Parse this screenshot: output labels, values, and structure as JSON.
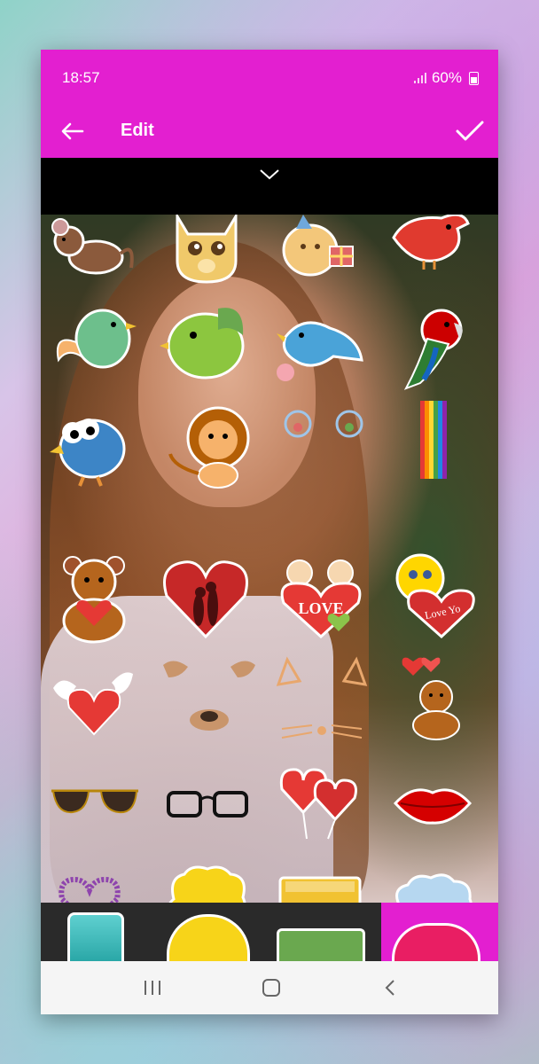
{
  "status_bar": {
    "time": "18:57",
    "battery": "60%"
  },
  "toolbar": {
    "title": "Edit"
  },
  "icons": {
    "back": "arrow-left-icon",
    "confirm": "checkmark-icon",
    "collapse": "chevron-down-icon",
    "nav_recent": "recent-apps-icon",
    "nav_home": "home-icon",
    "nav_back": "back-chevron-icon"
  },
  "stickers": {
    "love_heart_text": "LOVE",
    "love_you_text": "Love Yo"
  },
  "colors": {
    "accent": "#e31fd0"
  }
}
